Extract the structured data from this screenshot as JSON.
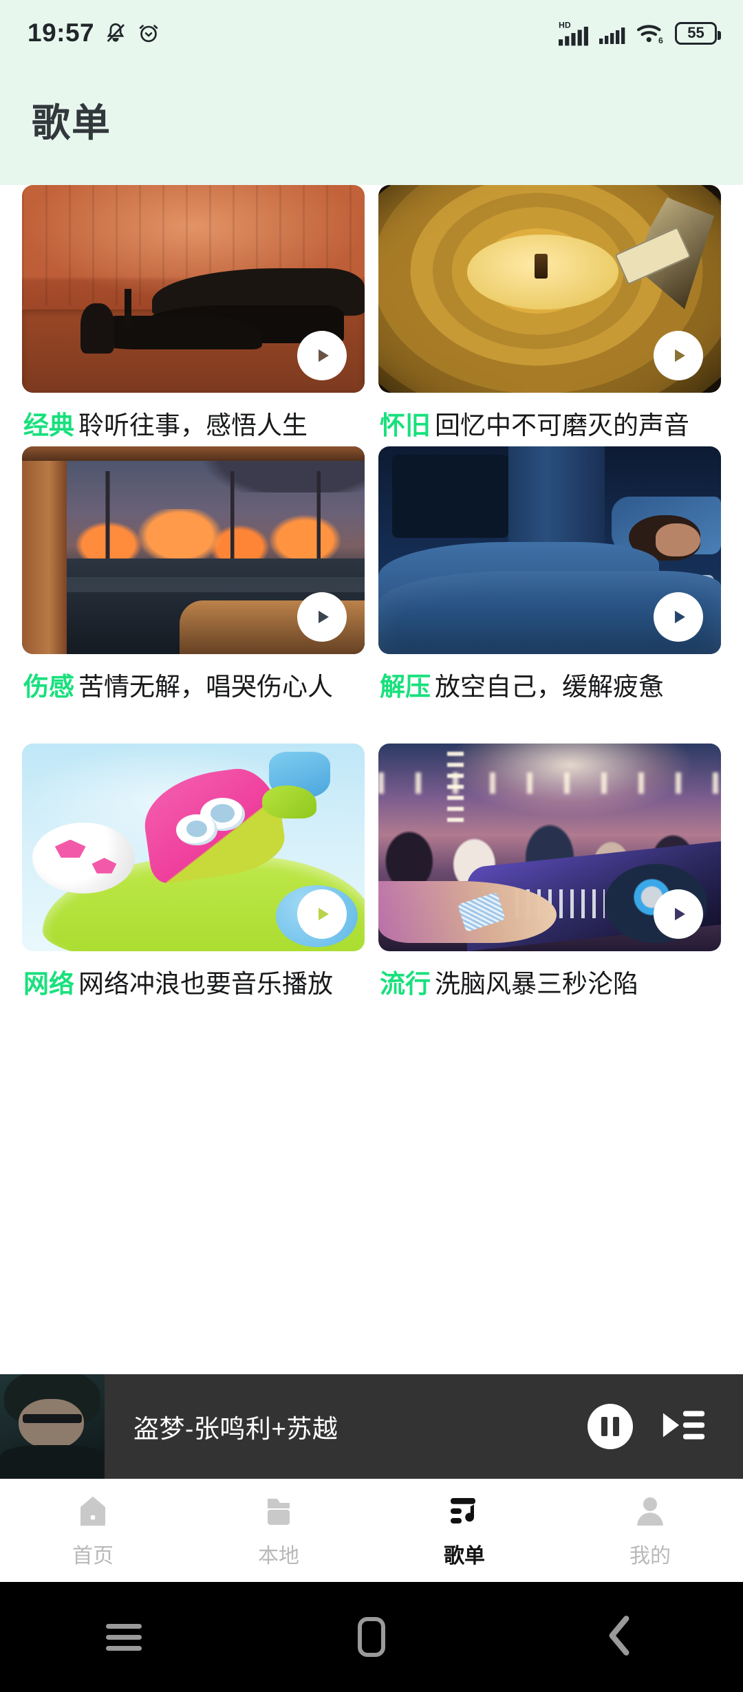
{
  "status_bar": {
    "time": "19:57",
    "battery_level": "55",
    "icons": [
      "bell-muted-icon",
      "alarm-clock-icon",
      "hd-signal-icon",
      "signal-icon",
      "wifi6-icon",
      "battery-icon"
    ],
    "network_label": "HD",
    "wifi_label": "6",
    "background": "#e8f7ee"
  },
  "header": {
    "title": "歌单"
  },
  "theme": {
    "accent_green": "#18e07c",
    "header_bg": "#e8f7ee",
    "player_bg": "#333333",
    "text_primary": "#18191b"
  },
  "playlists": [
    {
      "tag": "经典",
      "desc": "聆听往事，感悟人生",
      "art": "art-concert",
      "play_label": "播放"
    },
    {
      "tag": "怀旧",
      "desc": "回忆中不可磨灭的声音",
      "art": "art-vinyl",
      "play_label": "播放"
    },
    {
      "tag": "伤感",
      "desc": "苦情无解，唱哭伤心人",
      "art": "art-sunset",
      "play_label": "播放"
    },
    {
      "tag": "解压",
      "desc": "放空自己，缓解疲惫",
      "art": "art-sleep",
      "play_label": "播放"
    },
    {
      "tag": "网络",
      "desc": "网络冲浪也要音乐播放",
      "art": "art-toy",
      "play_label": "播放"
    },
    {
      "tag": "流行",
      "desc": "洗脑风暴三秒沦陷",
      "art": "art-dj",
      "play_label": "播放"
    }
  ],
  "mini_player": {
    "track": "盗梦-张鸣利+苏越",
    "pause_label": "暂停",
    "queue_label": "播放列表"
  },
  "bottom_nav": {
    "items": [
      {
        "label": "首页",
        "icon": "home-icon",
        "active": false
      },
      {
        "label": "本地",
        "icon": "folder-icon",
        "active": false
      },
      {
        "label": "歌单",
        "icon": "playlist-music-icon",
        "active": true
      },
      {
        "label": "我的",
        "icon": "person-icon",
        "active": false
      }
    ]
  },
  "android_nav": {
    "items": [
      {
        "name": "recents-icon"
      },
      {
        "name": "home-icon"
      },
      {
        "name": "back-icon"
      }
    ]
  }
}
